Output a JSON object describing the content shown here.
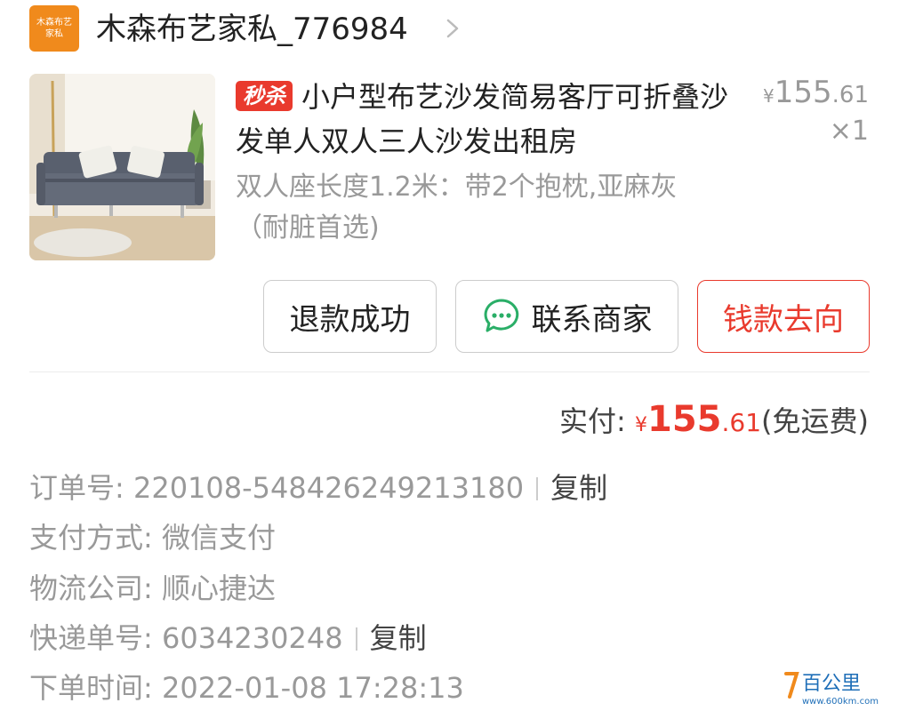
{
  "shop": {
    "logo_text": "木森布艺家私",
    "name": "木森布艺家私_776984"
  },
  "product": {
    "flash_tag": "秒杀",
    "title": "小户型布艺沙发简易客厅可折叠沙发单人双人三人沙发出租房",
    "spec": "双人座长度1.2米：带2个抱枕,亚麻灰（耐脏首选)",
    "price_symbol": "¥",
    "price_int": "155",
    "price_dec": ".61",
    "quantity": "×1"
  },
  "actions": {
    "refund_label": "退款成功",
    "contact_label": "联系商家",
    "money_flow_label": "钱款去向"
  },
  "payment": {
    "paid_label": "实付:",
    "symbol": "¥",
    "amount_int": "155",
    "amount_dec": ".61",
    "shipping_note": "(免运费)"
  },
  "order_info": {
    "order_no_label": "订单号:",
    "order_no": "220108-548426249213180",
    "copy_label": "复制",
    "pay_method_label": "支付方式:",
    "pay_method": "微信支付",
    "logistics_label": "物流公司:",
    "logistics": "顺心捷达",
    "tracking_label": "快递单号:",
    "tracking_no": "6034230248",
    "order_time_label": "下单时间:",
    "order_time": "2022-01-08 17:28:13"
  },
  "watermark": {
    "brand": "百公里",
    "url": "www.600km.com"
  },
  "colors": {
    "accent_red": "#e93a2d",
    "shop_orange": "#f08a1c",
    "wechat_green": "#2aae67"
  }
}
